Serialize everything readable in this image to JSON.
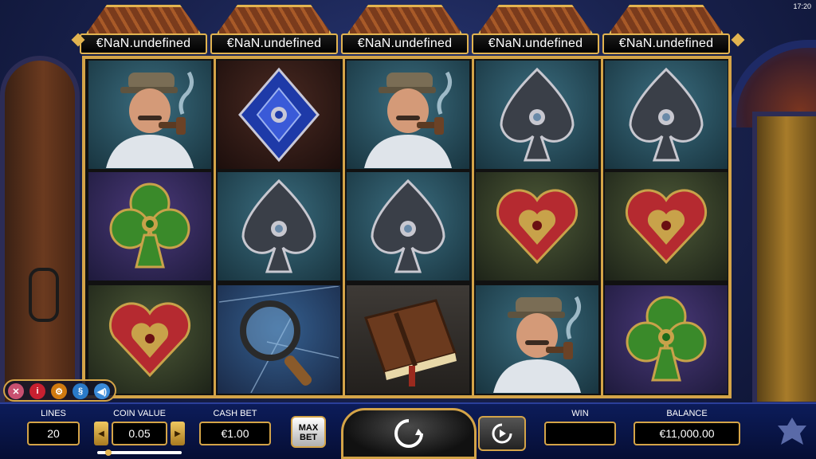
{
  "status": {
    "time": "17:20"
  },
  "reel_headers": [
    "€NaN.undefined",
    "€NaN.undefined",
    "€NaN.undefined",
    "€NaN.undefined",
    "€NaN.undefined"
  ],
  "reels": [
    [
      "detective",
      "club",
      "heart"
    ],
    [
      "diamond",
      "spade",
      "magnifying-glass"
    ],
    [
      "detective",
      "spade",
      "journal"
    ],
    [
      "spade",
      "heart",
      "detective"
    ],
    [
      "spade",
      "heart",
      "club"
    ]
  ],
  "controls": {
    "lines_label": "LINES",
    "lines_value": "20",
    "coin_value_label": "COIN VALUE",
    "coin_value": "0.05",
    "cash_bet_label": "CASH BET",
    "cash_bet_value": "€1.00",
    "max_bet_label_1": "MAX",
    "max_bet_label_2": "BET",
    "win_label": "WIN",
    "win_value": "",
    "balance_label": "BALANCE",
    "balance_value": "€11,000.00",
    "coin_value_level": 0.1
  },
  "menu": [
    "close-icon",
    "info-icon",
    "settings-icon",
    "rules-icon",
    "sound-icon"
  ],
  "colors": {
    "gold": "#d4a448",
    "panel": "#0c1c5a"
  }
}
